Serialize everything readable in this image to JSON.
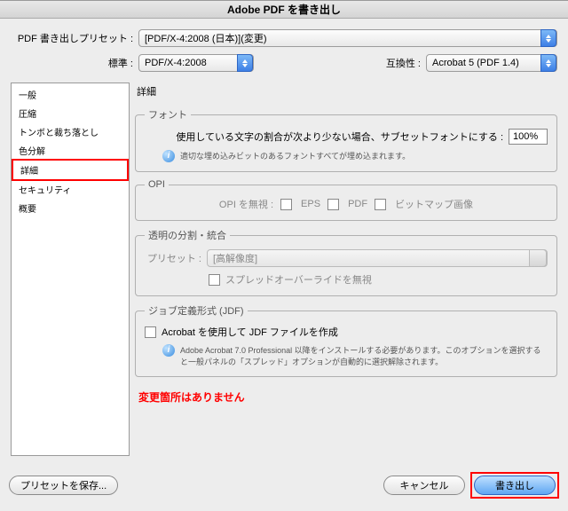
{
  "window_title": "Adobe PDF を書き出し",
  "preset": {
    "label": "PDF 書き出しプリセット :",
    "value": "[PDF/X-4:2008 (日本)](変更)"
  },
  "standard": {
    "label": "標準 :",
    "value": "PDF/X-4:2008"
  },
  "compat": {
    "label": "互換性 :",
    "value": "Acrobat 5 (PDF 1.4)"
  },
  "sidebar": {
    "items": [
      {
        "label": "一般"
      },
      {
        "label": "圧縮"
      },
      {
        "label": "トンボと裁ち落とし"
      },
      {
        "label": "色分解"
      },
      {
        "label": "詳細"
      },
      {
        "label": "セキュリティ"
      },
      {
        "label": "概要"
      }
    ],
    "selected_index": 4
  },
  "main": {
    "section_title": "詳細",
    "font": {
      "legend": "フォント",
      "label": "使用している文字の割合が次より少ない場合、サブセットフォントにする :",
      "value": "100%",
      "info": "適切な埋め込みビットのあるフォントすべてが埋め込まれます。"
    },
    "opi": {
      "legend": "OPI",
      "label": "OPI を無視 :",
      "eps": "EPS",
      "pdf": "PDF",
      "bitmap": "ビットマップ画像"
    },
    "transparency": {
      "legend": "透明の分割・統合",
      "preset_label": "プリセット :",
      "preset_value": "[高解像度]",
      "spread_override": "スプレッドオーバーライドを無視"
    },
    "jdf": {
      "legend": "ジョブ定義形式 (JDF)",
      "checkbox_label": "Acrobat を使用して JDF ファイルを作成",
      "info": "Adobe Acrobat 7.0 Professional 以降をインストールする必要があります。このオプションを選択すると一般パネルの「スプレッド」オプションが自動的に選択解除されます。"
    },
    "notice": "変更箇所はありません"
  },
  "footer": {
    "save_preset": "プリセットを保存...",
    "cancel": "キャンセル",
    "export": "書き出し"
  }
}
